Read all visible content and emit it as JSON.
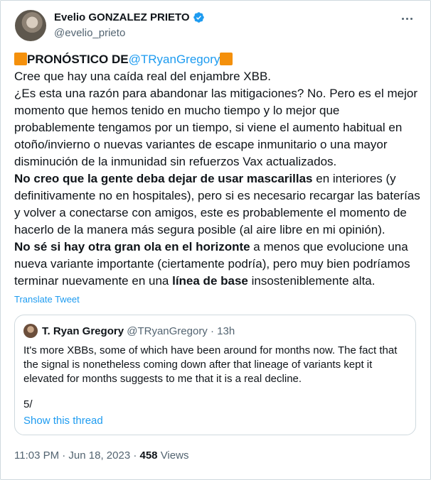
{
  "author": {
    "name": "Evelio GONZALEZ PRIETO",
    "handle": "@evelio_prieto"
  },
  "tweet": {
    "lines": [
      [
        {
          "t": "PRONÓSTICO DE",
          "b": true
        },
        {
          "t": "@TRyanGregory",
          "m": true
        }
      ],
      [
        {
          "t": "Cree que hay una caída real del enjambre XBB."
        }
      ],
      [
        {
          "t": "¿Es esta una razón para abandonar las mitigaciones? No. Pero es el mejor"
        }
      ],
      [
        {
          "t": "momento que hemos tenido en mucho tiempo y lo mejor que"
        }
      ],
      [
        {
          "t": "probablemente tengamos por un tiempo, si viene el aumento habitual en"
        }
      ],
      [
        {
          "t": "otoño/invierno o nuevas variantes de escape inmunitario o una mayor"
        }
      ],
      [
        {
          "t": "disminución de la inmunidad sin refuerzos Vax actualizados."
        }
      ],
      [
        {
          "t": "No creo que la gente deba dejar de usar mascarillas",
          "b": true
        },
        {
          "t": " en interiores (y"
        }
      ],
      [
        {
          "t": "definitivamente no en hospitales), pero si es necesario recargar las baterías"
        }
      ],
      [
        {
          "t": "y volver a conectarse con amigos, este es probablemente el momento de"
        }
      ],
      [
        {
          "t": "hacerlo de la manera más segura posible (al aire libre en mi opinión)."
        }
      ],
      [
        {
          "t": "No sé si hay otra gran ola en el horizonte",
          "b": true
        },
        {
          "t": " a menos que evolucione una"
        }
      ],
      [
        {
          "t": "nueva variante importante (ciertamente podría), pero muy bien podríamos"
        }
      ],
      [
        {
          "t": "terminar nuevamente en una "
        },
        {
          "t": "línea de base",
          "b": true
        },
        {
          "t": " insosteniblemente alta."
        }
      ]
    ],
    "translate_label": "Translate Tweet"
  },
  "quote": {
    "name": "T. Ryan Gregory",
    "handle": "@TRyanGregory",
    "separator": " · ",
    "time": "13h",
    "text": "It's more XBBs, some of which have been around for months now. The fact that the signal is nonetheless coming down after that lineage of variants kept it elevated for months suggests to me that it is a real decline.",
    "count": "5/",
    "thread_label": "Show this thread"
  },
  "footer": {
    "time": "11:03 PM · Jun 18, 2023 · ",
    "views_count": "458",
    "views_label": " Views"
  },
  "colors": {
    "accent": "#1d9bf0",
    "emoji_square": "#f4900c"
  },
  "icons": [
    "verified-badge-icon",
    "more-options-icon",
    "orange-square-icon"
  ]
}
